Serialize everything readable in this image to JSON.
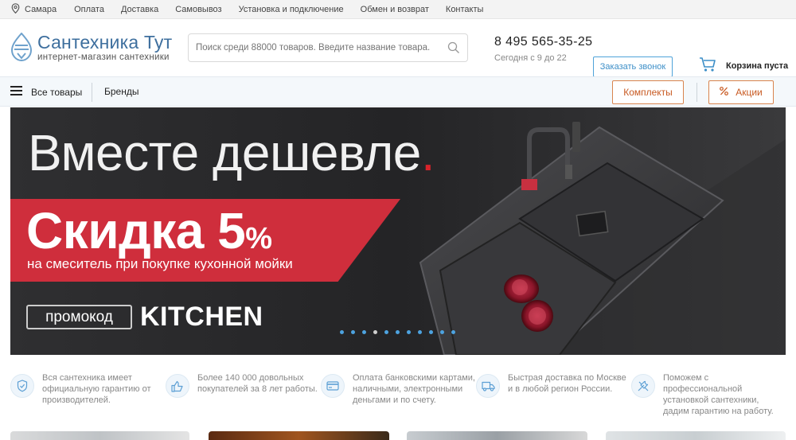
{
  "topbar": {
    "city": "Самара",
    "links": [
      "Оплата",
      "Доставка",
      "Самовывоз",
      "Установка и подключение",
      "Обмен и возврат",
      "Контакты"
    ]
  },
  "header": {
    "logo_title": "Сантехника Тут",
    "logo_sub": "интернет-магазин сантехники",
    "search_placeholder": "Поиск среди 88000 товаров. Введите название товара.",
    "phone": "8 495 565-35-25",
    "hours": "Сегодня с 9 до 22",
    "callback_label": "Заказать звонок",
    "cart_label": "Корзина пуста"
  },
  "nav": {
    "all_goods": "Все товары",
    "brands": "Бренды",
    "kits": "Комплекты",
    "promos": "Акции"
  },
  "banner": {
    "headline": "Вместе дешевле",
    "discount": "Скидка 5",
    "percent": "%",
    "subline": "на смеситель при покупке кухонной мойки",
    "promo_label": "промокод",
    "promo_code": "KITCHEN",
    "slide_count": 11,
    "active_slide": 4
  },
  "features": [
    {
      "icon": "shield-icon",
      "text": "Вся сантехника имеет официальную гарантию от производителей."
    },
    {
      "icon": "thumbs-up-icon",
      "text": "Более 140 000 довольных покупателей за 8 лет работы."
    },
    {
      "icon": "credit-card-icon",
      "text": "Оплата банковскими картами, наличными, электронными деньгами и по счету."
    },
    {
      "icon": "truck-icon",
      "text": "Быстрая доставка по Москве и в любой регион России."
    },
    {
      "icon": "tools-icon",
      "text": "Поможем с профессиональной установкой сантехники, дадим гарантию на работу."
    }
  ],
  "colors": {
    "accent_blue": "#3e6f9e",
    "accent_orange": "#c85a22",
    "banner_red": "#cf2e3c"
  }
}
